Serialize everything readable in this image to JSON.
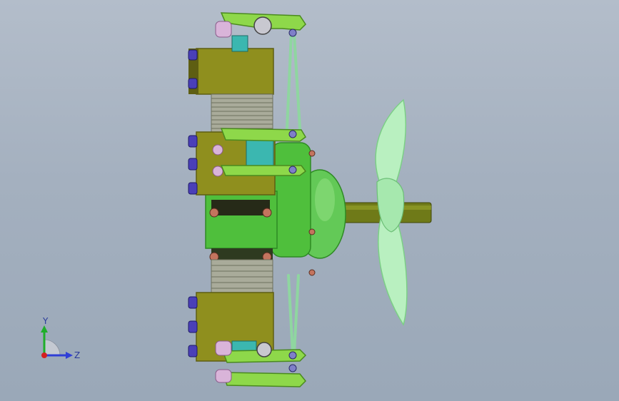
{
  "viewport": {
    "background_top": "#b3bdca",
    "background_bottom": "#9aa8b8"
  },
  "model": {
    "colors": {
      "crankcase": "#4fbf3c",
      "crankcase_dark": "#2e8a24",
      "nose_dome": "#63c957",
      "cylinder_head": "#8f8f1e",
      "cylinder_head_dark": "#5e5e12",
      "cylinder_fins": "#a9ab9a",
      "rocker": "#8ed84a",
      "pushrod": "#8fd6a0",
      "valve_spring": "#d9b4d9",
      "bolt_blue": "#4a3fb8",
      "cyan_block": "#3bb7b0",
      "prop": "#b9f0c0",
      "prop_edge": "#7ccf86",
      "shaft": "#6f7a18"
    }
  },
  "triad": {
    "y_label": "Y",
    "z_label": "Z",
    "y_color": "#1fae2a",
    "z_color": "#2f3fd6",
    "x_color": "#d42020"
  }
}
